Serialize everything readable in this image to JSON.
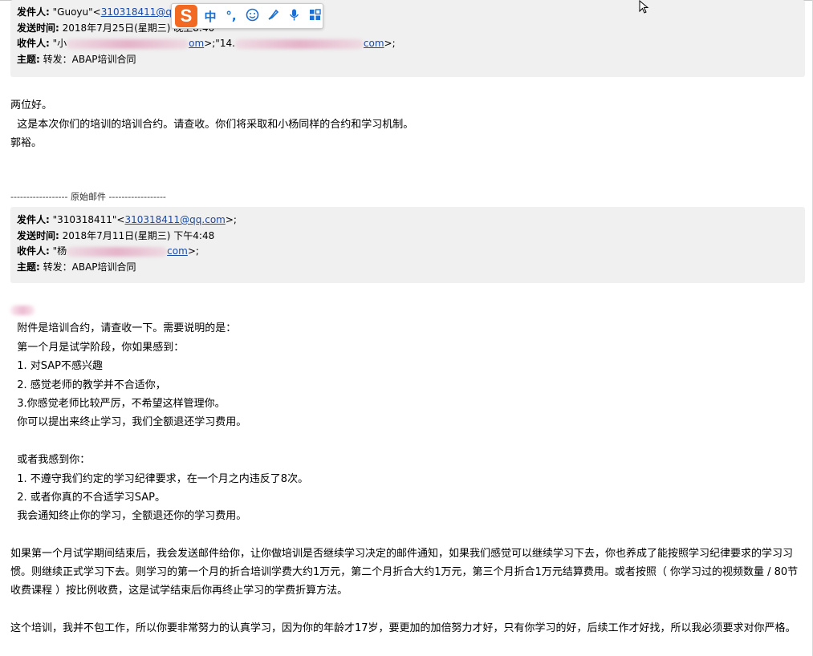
{
  "header1": {
    "from_label": "发件人:",
    "from_name": "\"Guoyu\"<",
    "from_email": "310318411@q",
    "sent_label": "发送时间:",
    "sent_value": "2018年7月25日(星期三) 晚上8:40",
    "to_label": "收件人:",
    "to_prefix": "\"小",
    "to_email1_tail": "om",
    "to_mid": ">;\"14.",
    "to_email2_tail": "com",
    "to_end": ">;",
    "subject_label": "主题:",
    "subject_value": "转发：ABAP培训合同"
  },
  "body1": {
    "lines": [
      "两位好。",
      "  这是本次你们的培训的培训合约。请查收。你们将采取和小杨同样的合约和学习机制。",
      "郭裕。"
    ]
  },
  "separator": "------------------ 原始邮件 ------------------",
  "header2": {
    "from_label": "发件人:",
    "from_name": "\"310318411\"<",
    "from_email": "310318411@qq.com",
    "from_end": ">;",
    "sent_label": "发送时间:",
    "sent_value": "2018年7月11日(星期三) 下午4:48",
    "to_label": "收件人:",
    "to_prefix": "\"杨",
    "to_email_tail": "com",
    "to_end": ">;",
    "subject_label": "主题:",
    "subject_value": "转发：ABAP培训合同"
  },
  "body2": {
    "l1": "  附件是培训合约，请查收一下。需要说明的是：",
    "l2": "  第一个月是试学阶段，你如果感到：",
    "l3": "  1. 对SAP不感兴趣",
    "l4": "  2. 感觉老师的教学并不合适你，",
    "l5": "  3.你感觉老师比较严厉，不希望这样管理你。",
    "l6": "  你可以提出来终止学习，我们全额退还学习费用。",
    "l7": "  或者我感到你：",
    "l8": "  1. 不遵守我们约定的学习纪律要求，在一个月之内违反了8次。",
    "l9": "  2. 或者你真的不合适学习SAP。",
    "l10": "  我会通知终止你的学习，全额退还你的学习费用。",
    "p1": "  如果第一个月试学期间结束后，我会发送邮件给你，让你做培训是否继续学习决定的邮件通知，如果我们感觉可以继续学习下去，你也养成了能按照学习纪律要求的学习习惯。则继续正式学习下去。则学习的第一个月的折合培训学费大约1万元，第二个月折合大约1万元，第三个月折合1万元结算费用。或者按照（ 你学习过的视频数量 / 80节收费课程 ）按比例收费，这是试学结束后你再终止学习的学费折算方法。",
    "p2": "  这个培训，我并不包工作，所以你要非常努力的认真学习，因为你的年龄才17岁，要更加的加倍努力才好，只有你学习的好，后续工作才好找，所以我必须要求对你严格。"
  },
  "ime": {
    "logo": "S",
    "mode": "中",
    "punct": "°,",
    "items": [
      "smiley-icon",
      "brush-icon",
      "microphone-icon",
      "grid-icon"
    ]
  },
  "colors": {
    "link": "#1a4aa8",
    "header_bg": "#f0f0f0",
    "ime_logo": "#f26a21",
    "ime_icons": "#1c6fd2"
  }
}
